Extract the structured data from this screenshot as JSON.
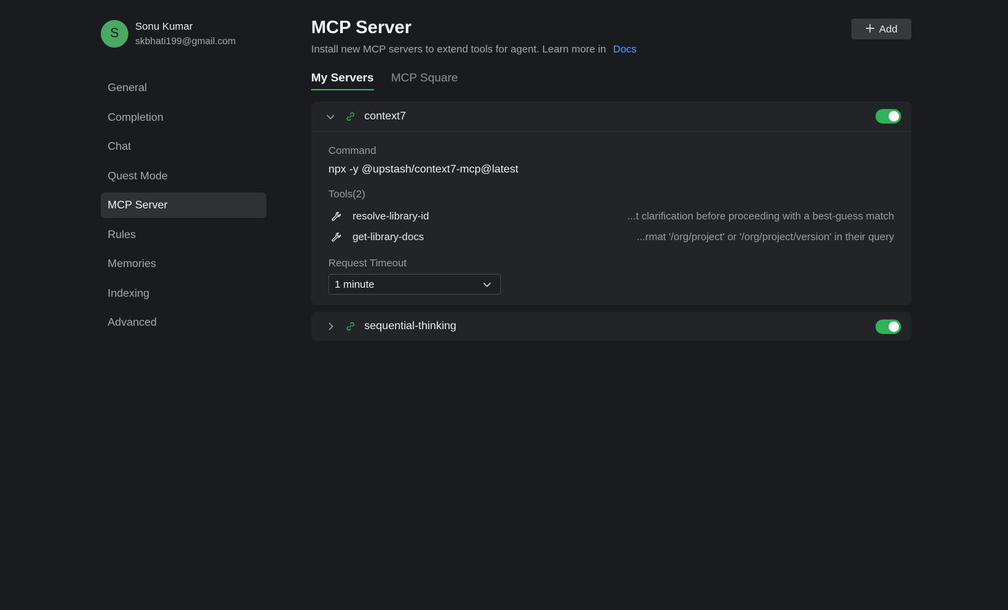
{
  "profile": {
    "initial": "S",
    "name": "Sonu Kumar",
    "email": "skbhati199@gmail.com",
    "avatar_color": "#4aa865"
  },
  "nav": {
    "items": [
      {
        "label": "General"
      },
      {
        "label": "Completion"
      },
      {
        "label": "Chat"
      },
      {
        "label": "Quest Mode"
      },
      {
        "label": "MCP Server",
        "active": true
      },
      {
        "label": "Rules"
      },
      {
        "label": "Memories"
      },
      {
        "label": "Indexing"
      },
      {
        "label": "Advanced"
      }
    ]
  },
  "header": {
    "title": "MCP Server",
    "subtitle": "Install new MCP servers to extend tools for agent. Learn more in",
    "docs_link": "Docs",
    "add_label": "Add"
  },
  "tabs": [
    {
      "label": "My Servers",
      "active": true
    },
    {
      "label": "MCP Square"
    }
  ],
  "servers": [
    {
      "name": "context7",
      "enabled": true,
      "expanded": true,
      "command_label": "Command",
      "command": "npx -y @upstash/context7-mcp@latest",
      "tools_label": "Tools(2)",
      "tools": [
        {
          "name": "resolve-library-id",
          "desc": "...t clarification before proceeding with a best-guess match",
          "icon": "wrench-icon"
        },
        {
          "name": "get-library-docs",
          "desc": "...rmat '/org/project' or '/org/project/version' in their query",
          "icon": "wrench-icon"
        }
      ],
      "timeout_label": "Request Timeout",
      "timeout_value": "1 minute"
    },
    {
      "name": "sequential-thinking",
      "enabled": true,
      "expanded": false
    }
  ],
  "colors": {
    "accent_green": "#2fb35a",
    "link_blue": "#4da3ff",
    "background": "#1a1b1e",
    "card": "#232427"
  }
}
